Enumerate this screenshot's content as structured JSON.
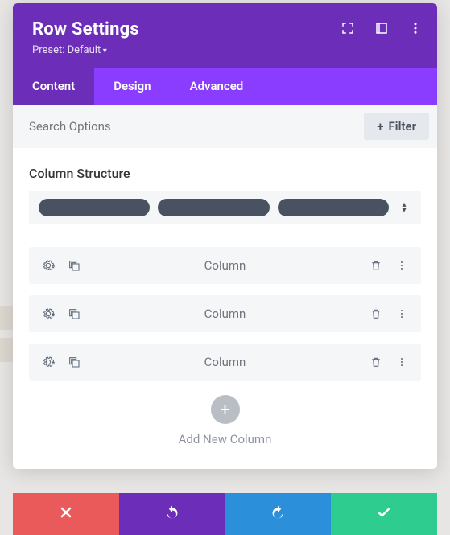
{
  "header": {
    "title": "Row Settings",
    "preset": "Preset: Default"
  },
  "tabs": {
    "content": "Content",
    "design": "Design",
    "advanced": "Advanced"
  },
  "search": {
    "placeholder": "Search Options",
    "filter": "Filter"
  },
  "section": {
    "title": "Column Structure"
  },
  "columns": [
    {
      "label": "Column"
    },
    {
      "label": "Column"
    },
    {
      "label": "Column"
    }
  ],
  "add": {
    "label": "Add New Column"
  }
}
